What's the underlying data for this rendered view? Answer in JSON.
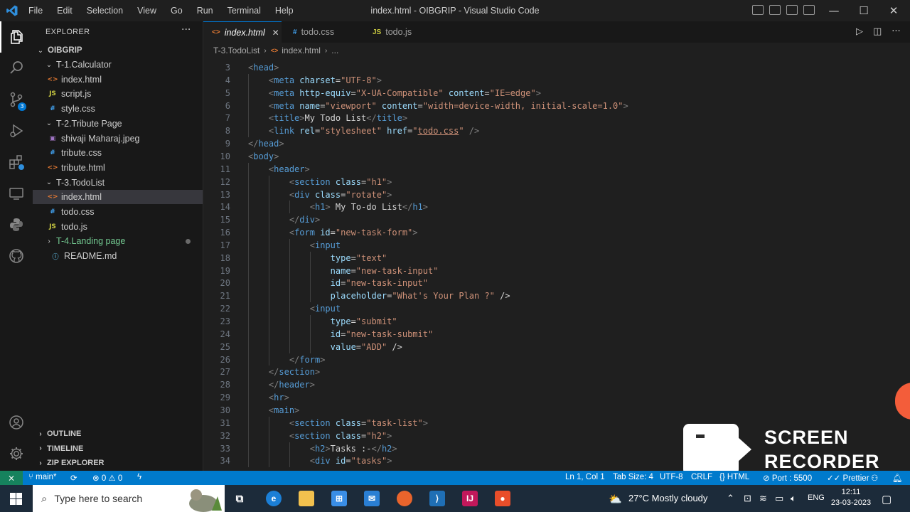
{
  "window": {
    "title": "index.html - OIBGRIP - Visual Studio Code",
    "menu": [
      "File",
      "Edit",
      "Selection",
      "View",
      "Go",
      "Run",
      "Terminal",
      "Help"
    ],
    "controls": {
      "minimize": "—",
      "maximize": "☐",
      "close": "✕"
    }
  },
  "activity_bar": {
    "items": [
      "explorer",
      "search",
      "source-control",
      "run-debug",
      "extensions",
      "remote-explorer",
      "python",
      "github"
    ],
    "source_control_badge": "3",
    "bottom": [
      "accounts",
      "manage"
    ]
  },
  "explorer": {
    "header": "EXPLORER",
    "more": "···",
    "root": "OIBGRIP",
    "tree": [
      {
        "label": "T-1.Calculator",
        "type": "folder",
        "open": true,
        "depth": 1
      },
      {
        "label": "index.html",
        "type": "html",
        "depth": 2
      },
      {
        "label": "script.js",
        "type": "js",
        "depth": 2
      },
      {
        "label": "style.css",
        "type": "css",
        "depth": 2
      },
      {
        "label": "T-2.Tribute Page",
        "type": "folder",
        "open": true,
        "depth": 1
      },
      {
        "label": "shivaji Maharaj.jpeg",
        "type": "img",
        "depth": 2
      },
      {
        "label": "tribute.css",
        "type": "css",
        "depth": 2
      },
      {
        "label": "tribute.html",
        "type": "html",
        "depth": 2
      },
      {
        "label": "T-3.TodoList",
        "type": "folder",
        "open": true,
        "depth": 1
      },
      {
        "label": "index.html",
        "type": "html",
        "depth": 2,
        "selected": true
      },
      {
        "label": "todo.css",
        "type": "css",
        "depth": 2
      },
      {
        "label": "todo.js",
        "type": "js",
        "depth": 2
      },
      {
        "label": "T-4.Landing page",
        "type": "folder",
        "open": false,
        "depth": 1,
        "modified": true
      },
      {
        "label": "README.md",
        "type": "md",
        "depth": 1
      }
    ],
    "sections": [
      "OUTLINE",
      "TIMELINE",
      "ZIP EXPLORER"
    ]
  },
  "tabs": [
    {
      "label": "index.html",
      "type": "html",
      "active": true,
      "close": "✕"
    },
    {
      "label": "todo.css",
      "type": "css",
      "active": false
    },
    {
      "label": "todo.js",
      "type": "js",
      "active": false
    }
  ],
  "breadcrumb": [
    "T-3.TodoList",
    "index.html",
    "..."
  ],
  "editor": {
    "language": "html",
    "lines": [
      {
        "n": 3,
        "indent": 0,
        "code": "<head>"
      },
      {
        "n": 4,
        "indent": 1,
        "code": "<meta charset=\"UTF-8\">"
      },
      {
        "n": 5,
        "indent": 1,
        "code": "<meta http-equiv=\"X-UA-Compatible\" content=\"IE=edge\">"
      },
      {
        "n": 6,
        "indent": 1,
        "code": "<meta name=\"viewport\" content=\"width=device-width, initial-scale=1.0\">"
      },
      {
        "n": 7,
        "indent": 1,
        "code": "<title>My Todo List</title>"
      },
      {
        "n": 8,
        "indent": 1,
        "code": "<link rel=\"stylesheet\" href=\"todo.css\" />"
      },
      {
        "n": 9,
        "indent": 0,
        "code": "</head>"
      },
      {
        "n": 10,
        "indent": 0,
        "code": "<body>"
      },
      {
        "n": 11,
        "indent": 1,
        "code": "<header>"
      },
      {
        "n": 12,
        "indent": 2,
        "code": "<section class=\"h1\">"
      },
      {
        "n": 13,
        "indent": 2,
        "code": "<div class=\"rotate\">"
      },
      {
        "n": 14,
        "indent": 3,
        "code": "<h1> My To-do List</h1>"
      },
      {
        "n": 15,
        "indent": 2,
        "code": "</div>"
      },
      {
        "n": 16,
        "indent": 2,
        "code": "<form id=\"new-task-form\">"
      },
      {
        "n": 17,
        "indent": 3,
        "code": "<input"
      },
      {
        "n": 18,
        "indent": 4,
        "code": "type=\"text\""
      },
      {
        "n": 19,
        "indent": 4,
        "code": "name=\"new-task-input\""
      },
      {
        "n": 20,
        "indent": 4,
        "code": "id=\"new-task-input\""
      },
      {
        "n": 21,
        "indent": 4,
        "code": "placeholder=\"What's Your Plan ?\" />"
      },
      {
        "n": 22,
        "indent": 3,
        "code": "<input"
      },
      {
        "n": 23,
        "indent": 4,
        "code": "type=\"submit\""
      },
      {
        "n": 24,
        "indent": 4,
        "code": "id=\"new-task-submit\""
      },
      {
        "n": 25,
        "indent": 4,
        "code": "value=\"ADD\" />"
      },
      {
        "n": 26,
        "indent": 2,
        "code": "</form>"
      },
      {
        "n": 27,
        "indent": 1,
        "code": "</section>"
      },
      {
        "n": 28,
        "indent": 1,
        "code": "</header>"
      },
      {
        "n": 29,
        "indent": 1,
        "code": "<hr>"
      },
      {
        "n": 30,
        "indent": 1,
        "code": "<main>"
      },
      {
        "n": 31,
        "indent": 2,
        "code": "<section class=\"task-list\">"
      },
      {
        "n": 32,
        "indent": 2,
        "code": "<section class=\"h2\">"
      },
      {
        "n": 33,
        "indent": 3,
        "code": "<h2>Tasks :-</h2>"
      },
      {
        "n": 34,
        "indent": 3,
        "code": "<div id=\"tasks\">"
      }
    ]
  },
  "status_bar": {
    "branch": "main*",
    "problems": "⊗ 0 ⚠ 0",
    "position": "Ln 1, Col 1",
    "tab_size": "Tab Size: 4",
    "encoding": "UTF-8",
    "eol": "CRLF",
    "language": "HTML",
    "port": "Port : 5500",
    "formatter": "Prettier"
  },
  "overlay": {
    "line1": "SCREEN",
    "line2": "RECORDER"
  },
  "taskbar": {
    "search_placeholder": "Type here to search",
    "weather": "27°C  Mostly cloudy",
    "language": "ENG",
    "time": "12:11",
    "date": "23-03-2023"
  },
  "colors": {
    "accent": "#007acc",
    "tag": "#569cd6",
    "attribute": "#9cdcfe",
    "string": "#ce9178",
    "html_icon": "#e37933",
    "css_icon": "#42a5f5",
    "js_icon": "#cbcb41"
  }
}
